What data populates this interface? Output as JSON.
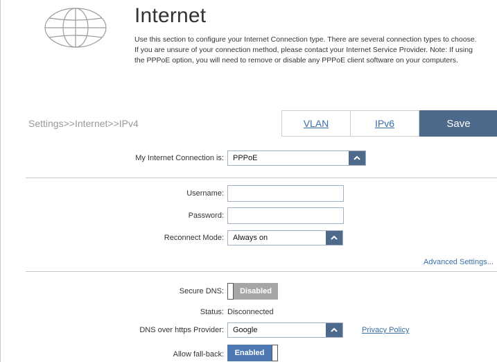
{
  "header": {
    "title": "Internet",
    "description": "Use this section to configure your Internet Connection type. There are several connection types to choose. If you are unsure of your connection method, please contact your Internet Service Provider. Note: If using the PPPoE option, you will need to remove or disable any PPPoE client software on your computers."
  },
  "breadcrumb": "Settings>>Internet>>IPv4",
  "tabs": {
    "vlan": "VLAN",
    "ipv6": "IPv6",
    "save": "Save"
  },
  "connection": {
    "label": "My Internet Connection is:",
    "value": "PPPoE"
  },
  "pppoe": {
    "username_label": "Username:",
    "username_value": "",
    "password_label": "Password:",
    "password_value": "",
    "reconnect_label": "Reconnect Mode:",
    "reconnect_value": "Always on"
  },
  "advanced_link": "Advanced Settings...",
  "dns": {
    "secure_label": "Secure DNS:",
    "secure_state": "Disabled",
    "status_label": "Status:",
    "status_value": "Disconnected",
    "provider_label": "DNS over https Provider:",
    "provider_value": "Google",
    "privacy_link": "Privacy Policy",
    "fallback_label": "Allow fall-back:",
    "fallback_state": "Enabled"
  },
  "colors": {
    "accent": "#4d6a8c",
    "link": "#3a6ea8",
    "toggle_on": "#4d78b4",
    "toggle_off": "#a6a6a6"
  },
  "icons": {
    "header": "globe-icon",
    "dropdown": "chevron-up-icon"
  }
}
